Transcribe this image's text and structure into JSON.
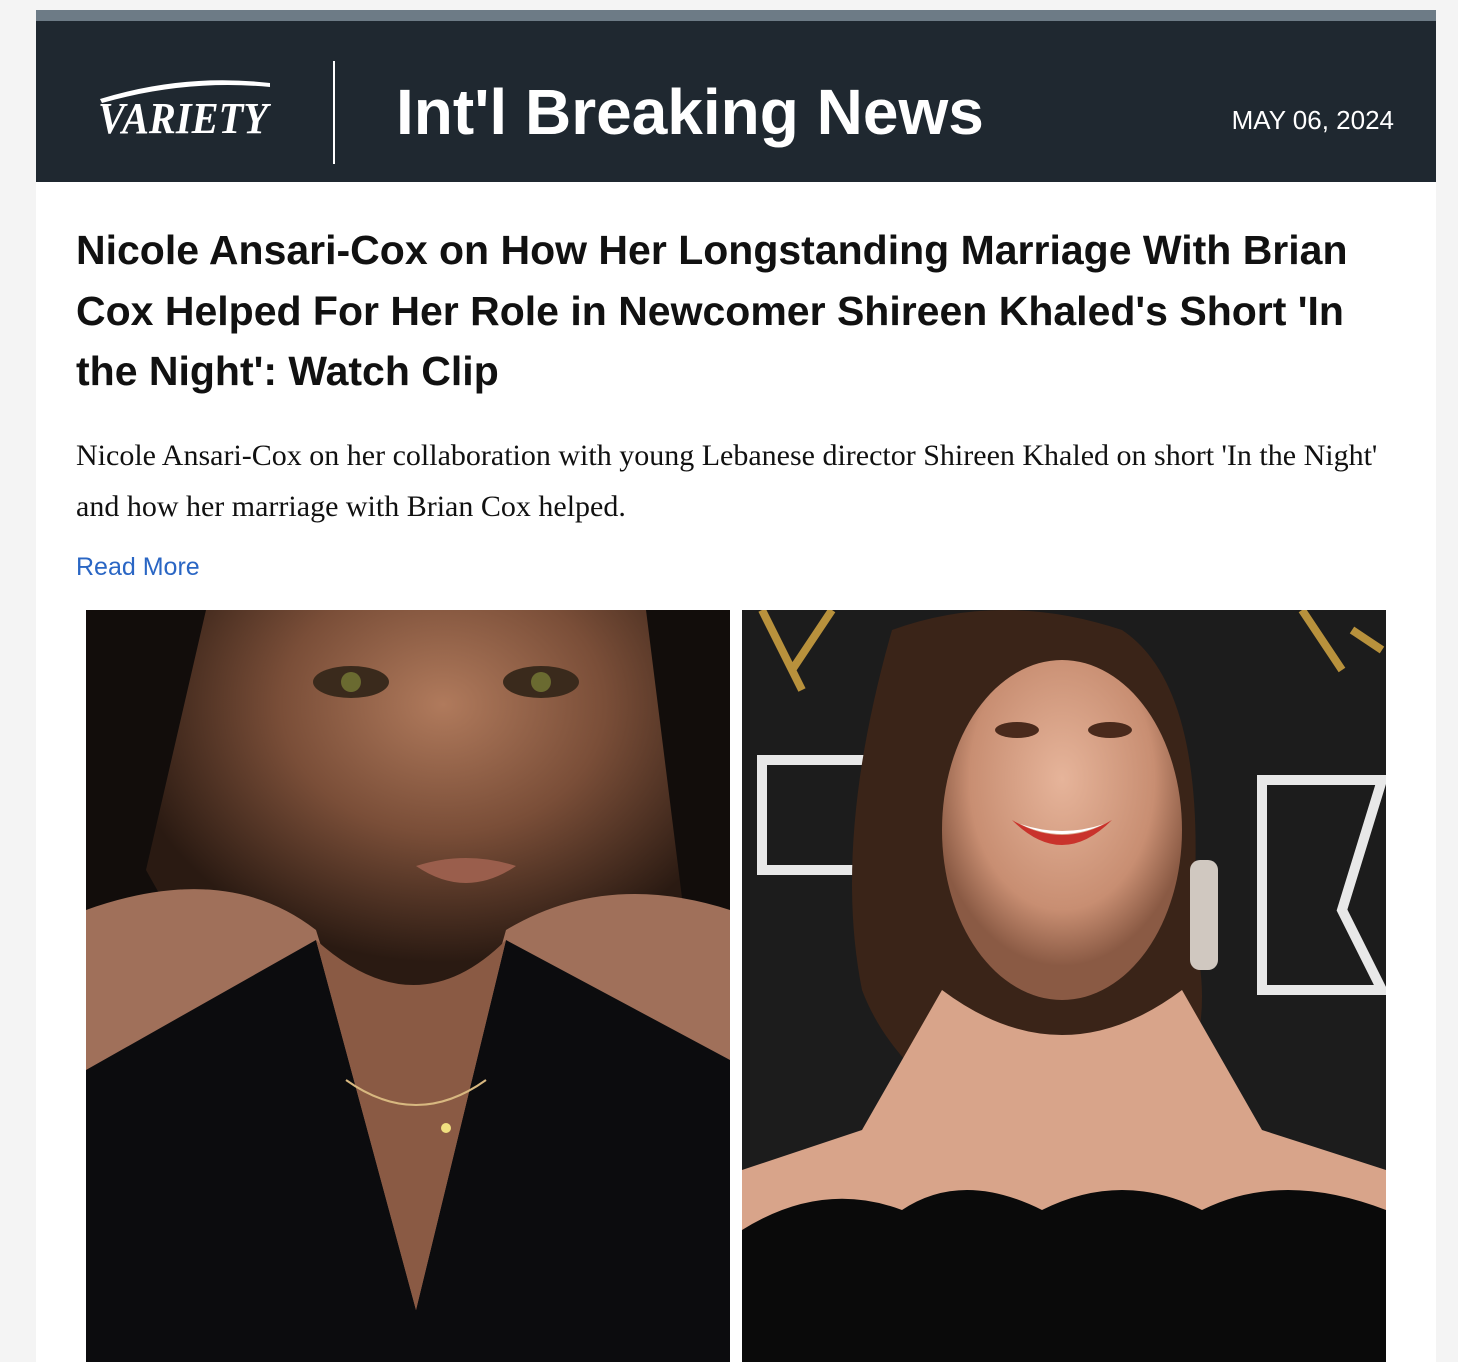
{
  "header": {
    "logo_text": "VARIETY",
    "title": "Int'l Breaking News",
    "date": "MAY 06, 2024"
  },
  "article": {
    "headline": "Nicole Ansari-Cox on How Her Longstanding Marriage With Brian Cox Helped For Her Role in Newcomer Shireen Khaled's Short 'In the Night': Watch Clip",
    "dek": "Nicole Ansari-Cox on her collaboration with young Lebanese director Shireen Khaled on short 'In the Night' and how her marriage with Brian Cox helped.",
    "read_more": "Read More"
  },
  "colors": {
    "header_bg": "#1f2830",
    "top_strip": "#6d7b86",
    "link": "#2a66c4",
    "headline": "#111111"
  }
}
